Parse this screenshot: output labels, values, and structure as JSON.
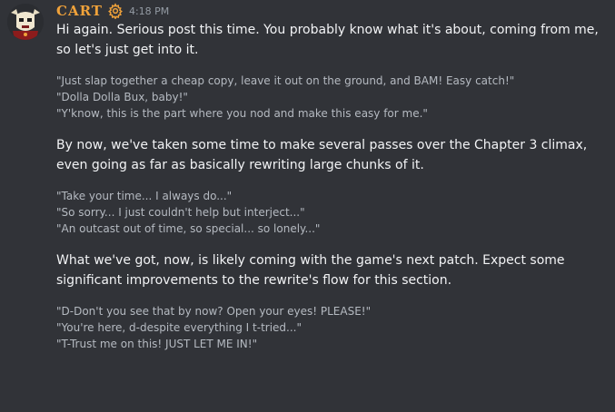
{
  "message": {
    "username": "CART",
    "timestamp": "4:18 PM",
    "avatar_icon": "bull-skull-avatar",
    "role_icon": "gear-icon",
    "colors": {
      "username": "#f0a23a",
      "background": "#313338",
      "body_text": "#f2f3f5",
      "quote_text": "#b5bac1",
      "timestamp": "#949ba4"
    },
    "paragraph_1": "Hi again. Serious post this time. You probably know what it's about, coming from me, so let's just get into it.",
    "quotes_1": [
      "\"Just slap together a cheap copy, leave it out on the ground, and BAM! Easy catch!\"",
      "\"Dolla Dolla Bux, baby!\"",
      "\"Y'know, this is the part where you nod and make this easy for me.\""
    ],
    "paragraph_2": "By now, we've taken some time to make several passes over the Chapter 3 climax, even going as far as basically rewriting large chunks of it.",
    "quotes_2": [
      "\"Take your time... I always do...\"",
      "\"So sorry... I just couldn't help but interject...\"",
      "\"An outcast out of time, so special... so lonely...\""
    ],
    "paragraph_3": "What we've got, now, is likely coming with the game's next patch. Expect some significant improvements to the rewrite's flow for this section.",
    "quotes_3": [
      "\"D-Don't you see that by now? Open your eyes! PLEASE!\"",
      "\"You're here, d-despite everything I t-tried...\"",
      "\"T-Trust me on this! JUST LET ME IN!\""
    ]
  }
}
